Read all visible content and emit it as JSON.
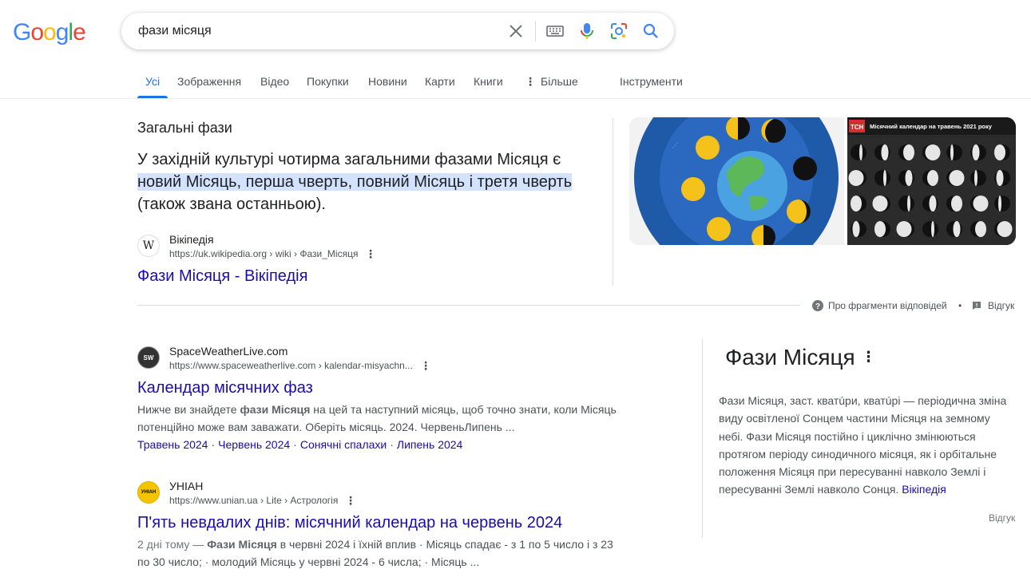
{
  "logo": {
    "letters": [
      "G",
      "o",
      "o",
      "g",
      "l",
      "e"
    ]
  },
  "search": {
    "query": "фази місяця"
  },
  "tabs": [
    {
      "label": "Усі"
    },
    {
      "label": "Зображення"
    },
    {
      "label": "Відео"
    },
    {
      "label": "Покупки"
    },
    {
      "label": "Новини"
    },
    {
      "label": "Карти"
    },
    {
      "label": "Книги"
    },
    {
      "label": "Більше"
    },
    {
      "label": "Інструменти"
    }
  ],
  "featured": {
    "title": "Загальні фази",
    "text_before": "У західній культурі чотирма загальними фазами Місяця є ",
    "text_highlight": "новий Місяць, перша чверть, повний Місяць і третя чверть",
    "text_after": " (також звана останньою).",
    "source_name": "Вікіпедія",
    "source_url": "https://uk.wikipedia.org › wiki › Фази_Місяця",
    "favicon_letter": "W",
    "link": "Фази Місяця - Вікіпедія",
    "image2_caption": "Місячний календар на травень 2021 року",
    "image2_logo": "ТСН",
    "about_label": "Про фрагменти відповідей",
    "feedback_label": "Відгук"
  },
  "results": [
    {
      "site": "SpaceWeatherLive.com",
      "url": "https://www.spaceweatherlive.com › kalendar-misyachn...",
      "favicon_text": "SW",
      "title": "Календар місячних фаз",
      "snippet_a": "Нижче ви знайдете ",
      "snippet_b": "фази Місяця",
      "snippet_c": " на цей та наступний місяць, щоб точно знати, коли Місяць потенційно може вам заважати. Оберіть місяць. 2024. ЧервеньЛипень ...",
      "sitelinks": [
        "Травень 2024",
        "Червень 2024",
        "Сонячні спалахи",
        "Липень 2024"
      ]
    },
    {
      "site": "УНІАН",
      "url": "https://www.unian.ua › Lite › Астрологія",
      "favicon_text": "УНІАН",
      "title": "П'ять невдалих днів: місячний календар на червень 2024",
      "snippet_a": "2 дні тому — ",
      "snippet_b": "Фази Місяця",
      "snippet_c": " в червні 2024 і їхній вплив · Місяць спадає - з 1 по 5 число і з 23 по 30 число; · молодий Місяць у червні 2024 - 6 числа; · Місяць ..."
    }
  ],
  "knowledge_panel": {
    "title": "Фази Місяця",
    "description": "Фази Місяця, заст. кватúри, кватúрі — періодична зміна виду освітленої Сонцем частини Місяця на земному небі. Фази Місяця постійно і циклічно змінюються протягом періоду синодичного місяця, як і орбітальне положення Місяця при пересуванні навколо Землі і пересуванні Землі навколо Сонця. ",
    "source_link": "Вікіпедія",
    "feedback": "Відгук"
  },
  "colors": {
    "accent": "#1a73e8",
    "link": "#1a0dab",
    "highlight": "#d3e3fd"
  }
}
